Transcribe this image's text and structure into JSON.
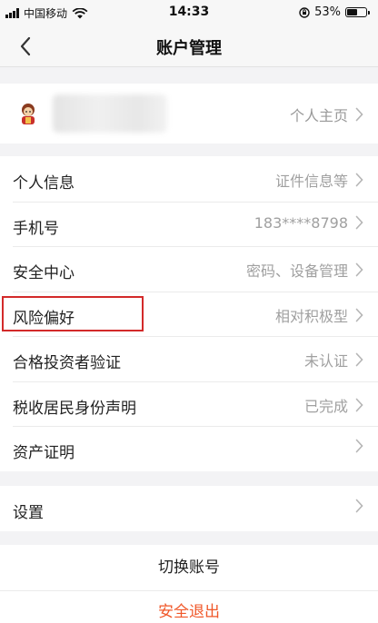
{
  "status_bar": {
    "carrier": "中国移动",
    "time": "14:33",
    "battery_percent": "53%",
    "battery_level": 0.53
  },
  "nav": {
    "title": "账户管理",
    "back_icon": "chevron-left-icon"
  },
  "profile": {
    "avatar_icon": "avatar-icon",
    "link_label": "个人主页"
  },
  "account_items": [
    {
      "label": "个人信息",
      "value": "证件信息等"
    },
    {
      "label": "手机号",
      "value": "183****8798"
    },
    {
      "label": "安全中心",
      "value": "密码、设备管理"
    },
    {
      "label": "风险偏好",
      "value": "相对积极型"
    },
    {
      "label": "合格投资者验证",
      "value": "未认证"
    },
    {
      "label": "税收居民身份声明",
      "value": "已完成"
    },
    {
      "label": "资产证明",
      "value": ""
    }
  ],
  "settings": {
    "label": "设置"
  },
  "actions": {
    "switch_account": "切换账号",
    "logout": "安全退出"
  },
  "colors": {
    "accent": "#f0582a",
    "highlight": "#d32a2a",
    "secondary_text": "#a0a0a0"
  }
}
